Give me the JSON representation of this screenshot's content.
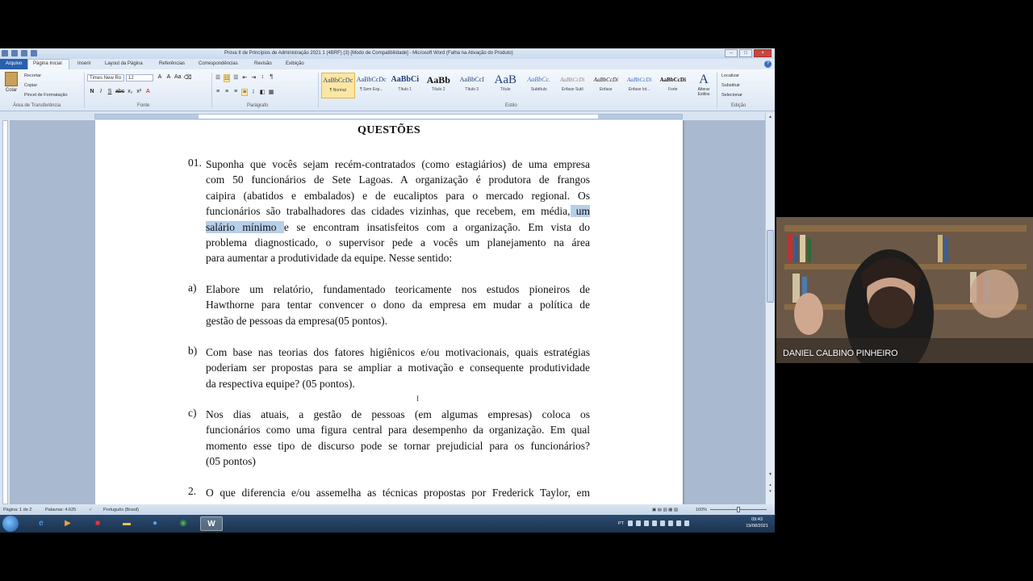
{
  "window": {
    "title": "Prova II de Princípios de Administração 2021 1 (4BRF) (3) [Modo de Compatibilidade] - Microsoft Word (Falha na Ativação do Produto)"
  },
  "tabs": {
    "file": "Arquivo",
    "items": [
      "Página Inicial",
      "Inserir",
      "Layout da Página",
      "Referências",
      "Correspondências",
      "Revisão",
      "Exibição"
    ]
  },
  "ribbon": {
    "clipboard": {
      "paste": "Colar",
      "cut": "Recortar",
      "copy": "Copiar",
      "format_painter": "Pincel de Formatação",
      "label": "Área de Transferência"
    },
    "font": {
      "family": "Times New Ro",
      "size": "12",
      "label": "Fonte"
    },
    "paragraph_label": "Parágrafo",
    "styles": [
      {
        "sample": "AaBbCcDc",
        "name": "¶ Normal"
      },
      {
        "sample": "AaBbCcDc",
        "name": "¶ Sem Esp..."
      },
      {
        "sample": "AaBbCi",
        "name": "Título 1"
      },
      {
        "sample": "AaBb",
        "name": "Título 2"
      },
      {
        "sample": "AaBbCcI",
        "name": "Título 3"
      },
      {
        "sample": "AaB",
        "name": "Título"
      },
      {
        "sample": "AaBbCc.",
        "name": "Subtítulo"
      },
      {
        "sample": "AaBbCcDi",
        "name": "Ênfase Sutil"
      },
      {
        "sample": "AaBbCcDi",
        "name": "Ênfase"
      },
      {
        "sample": "AaBbCcDi",
        "name": "Ênfase Int..."
      },
      {
        "sample": "AaBbCcDi",
        "name": "Forte"
      }
    ],
    "styles_label": "Estilo",
    "change_styles": "Alterar Estilos",
    "editing": {
      "find": "Localizar",
      "replace": "Substituir",
      "select": "Selecionar",
      "label": "Edição"
    }
  },
  "document": {
    "title": "QUESTÕES",
    "questions": [
      {
        "num": "01.",
        "lines": [
          "Suponha que vocês sejam recém-contratados (como estagiários) de uma empresa",
          "com 50 funcionários de Sete Lagoas. A organização é produtora de frangos",
          "caipira (abatidos e embalados) e de eucaliptos para o mercado regional. Os",
          "funcionários são trabalhadores das cidades vizinhas, que recebem, em média,",
          "e se encontram insatisfeitos com a organização. Em vista do",
          "problema diagnosticado, o supervisor pede a vocês um planejamento na área",
          "para aumentar a produtividade da equipe. Nesse sentido:"
        ],
        "highlight_a": " um",
        "highlight_b": "salário mínimo "
      },
      {
        "num": "a)",
        "lines": [
          "Elabore um relatório, fundamentado teoricamente nos estudos pioneiros de",
          "Hawthorne para tentar convencer o dono da empresa em mudar a política de",
          "gestão de pessoas da empresa(05 pontos)."
        ]
      },
      {
        "num": "b)",
        "lines": [
          "Com base nas teorias dos fatores higiênicos e/ou motivacionais, quais estratégias",
          "poderiam ser propostas para se ampliar a motivação e consequente produtividade",
          "da respectiva equipe? (05 pontos)."
        ]
      },
      {
        "num": "c)",
        "lines": [
          "Nos dias atuais, a gestão de pessoas (em algumas empresas) coloca os",
          "funcionários como uma figura central para desempenho da organização. Em qual",
          "momento esse tipo de discurso pode se tornar prejudicial para os funcionários?",
          "(05 pontos)"
        ]
      },
      {
        "num": "2.",
        "lines": [
          "O que diferencia e/ou assemelha as técnicas propostas por Frederick Taylor, em"
        ]
      }
    ]
  },
  "statusbar": {
    "page": "Página: 1 de 2",
    "words": "Palavras: 4.625",
    "language": "Português (Brasil)",
    "zoom": "160%"
  },
  "taskbar": {
    "lang": "PT",
    "time": "09:43",
    "date": "19/08/2021"
  },
  "video": {
    "participant": "DANIEL CALBINO PINHEIRO"
  }
}
